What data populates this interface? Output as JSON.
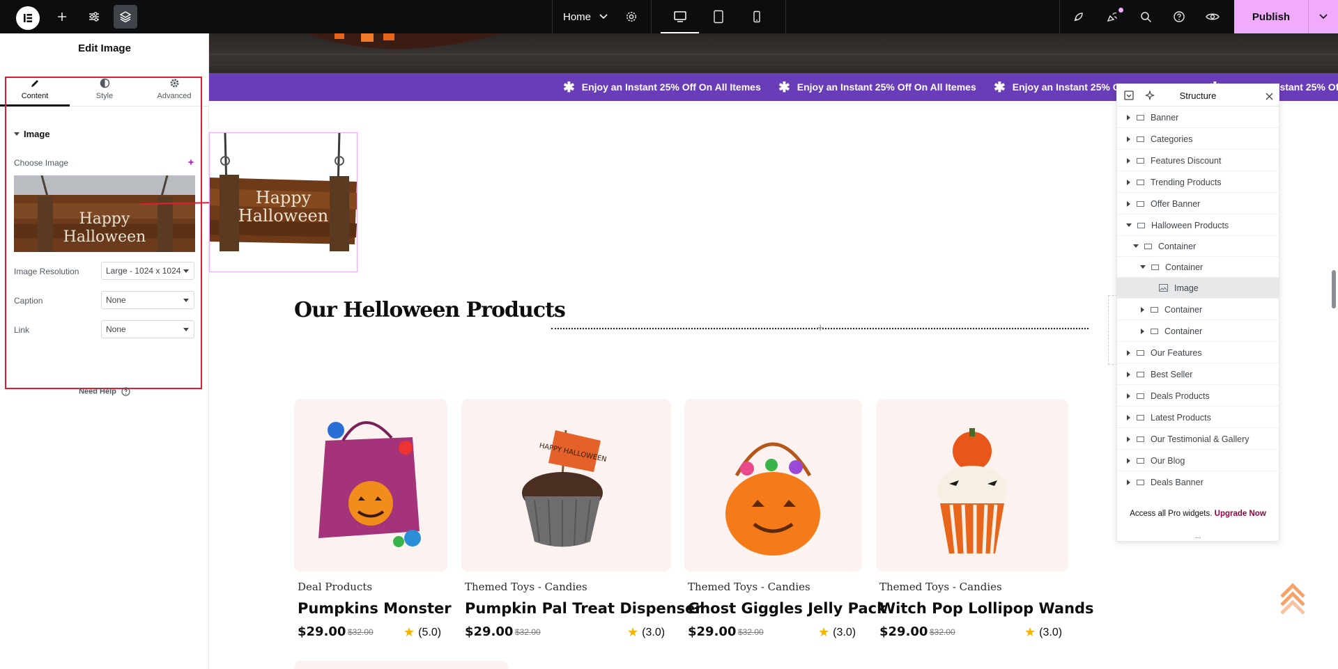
{
  "topbar": {
    "page_name": "Home",
    "publish_label": "Publish"
  },
  "panel": {
    "title": "Edit Image",
    "tabs": [
      {
        "label": "Content"
      },
      {
        "label": "Style"
      },
      {
        "label": "Advanced"
      }
    ],
    "section_title": "Image",
    "choose_image_label": "Choose Image",
    "image_preview_text": [
      "Happy",
      "Halloween"
    ],
    "fields": [
      {
        "label": "Image Resolution",
        "value": "Large - 1024 x 1024"
      },
      {
        "label": "Caption",
        "value": "None"
      },
      {
        "label": "Link",
        "value": "None"
      }
    ],
    "need_help": "Need Help"
  },
  "canvas": {
    "marquee_text": "Enjoy an Instant 25% Off On All Itemes",
    "sign_text": [
      "Happy",
      "Halloween"
    ],
    "section_heading": "Our Helloween Products",
    "products": [
      {
        "category": "Deal Products",
        "name": "Pumpkins Monster",
        "price": "$29.00",
        "old_price": "$32.00",
        "rating": "(5.0)"
      },
      {
        "category": "Themed Toys - Candies",
        "name": "Pumpkin Pal Treat Dispenser",
        "price": "$29.00",
        "old_price": "$32.00",
        "rating": "(3.0)"
      },
      {
        "category": "Themed Toys - Candies",
        "name": "Ghost Giggles Jelly Pack",
        "price": "$29.00",
        "old_price": "$32.00",
        "rating": "(3.0)"
      },
      {
        "category": "Themed Toys - Candies",
        "name": "Witch Pop Lollipop Wands",
        "price": "$29.00",
        "old_price": "$32.00",
        "rating": "(3.0)"
      }
    ],
    "cupcake_label": "HAPPY HALLOWEEN"
  },
  "structure": {
    "title": "Structure",
    "items": [
      {
        "label": "Banner"
      },
      {
        "label": "Categories"
      },
      {
        "label": "Features Discount"
      },
      {
        "label": "Trending Products"
      },
      {
        "label": "Offer Banner"
      },
      {
        "label": "Halloween Products"
      },
      {
        "label": "Container"
      },
      {
        "label": "Container"
      },
      {
        "label": "Image"
      },
      {
        "label": "Container"
      },
      {
        "label": "Container"
      },
      {
        "label": "Our Features"
      },
      {
        "label": "Best Seller"
      },
      {
        "label": "Deals Products"
      },
      {
        "label": "Latest Products"
      },
      {
        "label": "Our Testimonial & Gallery"
      },
      {
        "label": "Our Blog"
      },
      {
        "label": "Deals Banner"
      }
    ],
    "footer_text": "Access all Pro widgets.",
    "upgrade_label": "Upgrade Now",
    "more_label": "..."
  },
  "colors": {
    "accent": "#f0abfc",
    "marquee_bg": "#6a3db8",
    "selection_outline": "#e11d2e",
    "link": "#93003f"
  }
}
